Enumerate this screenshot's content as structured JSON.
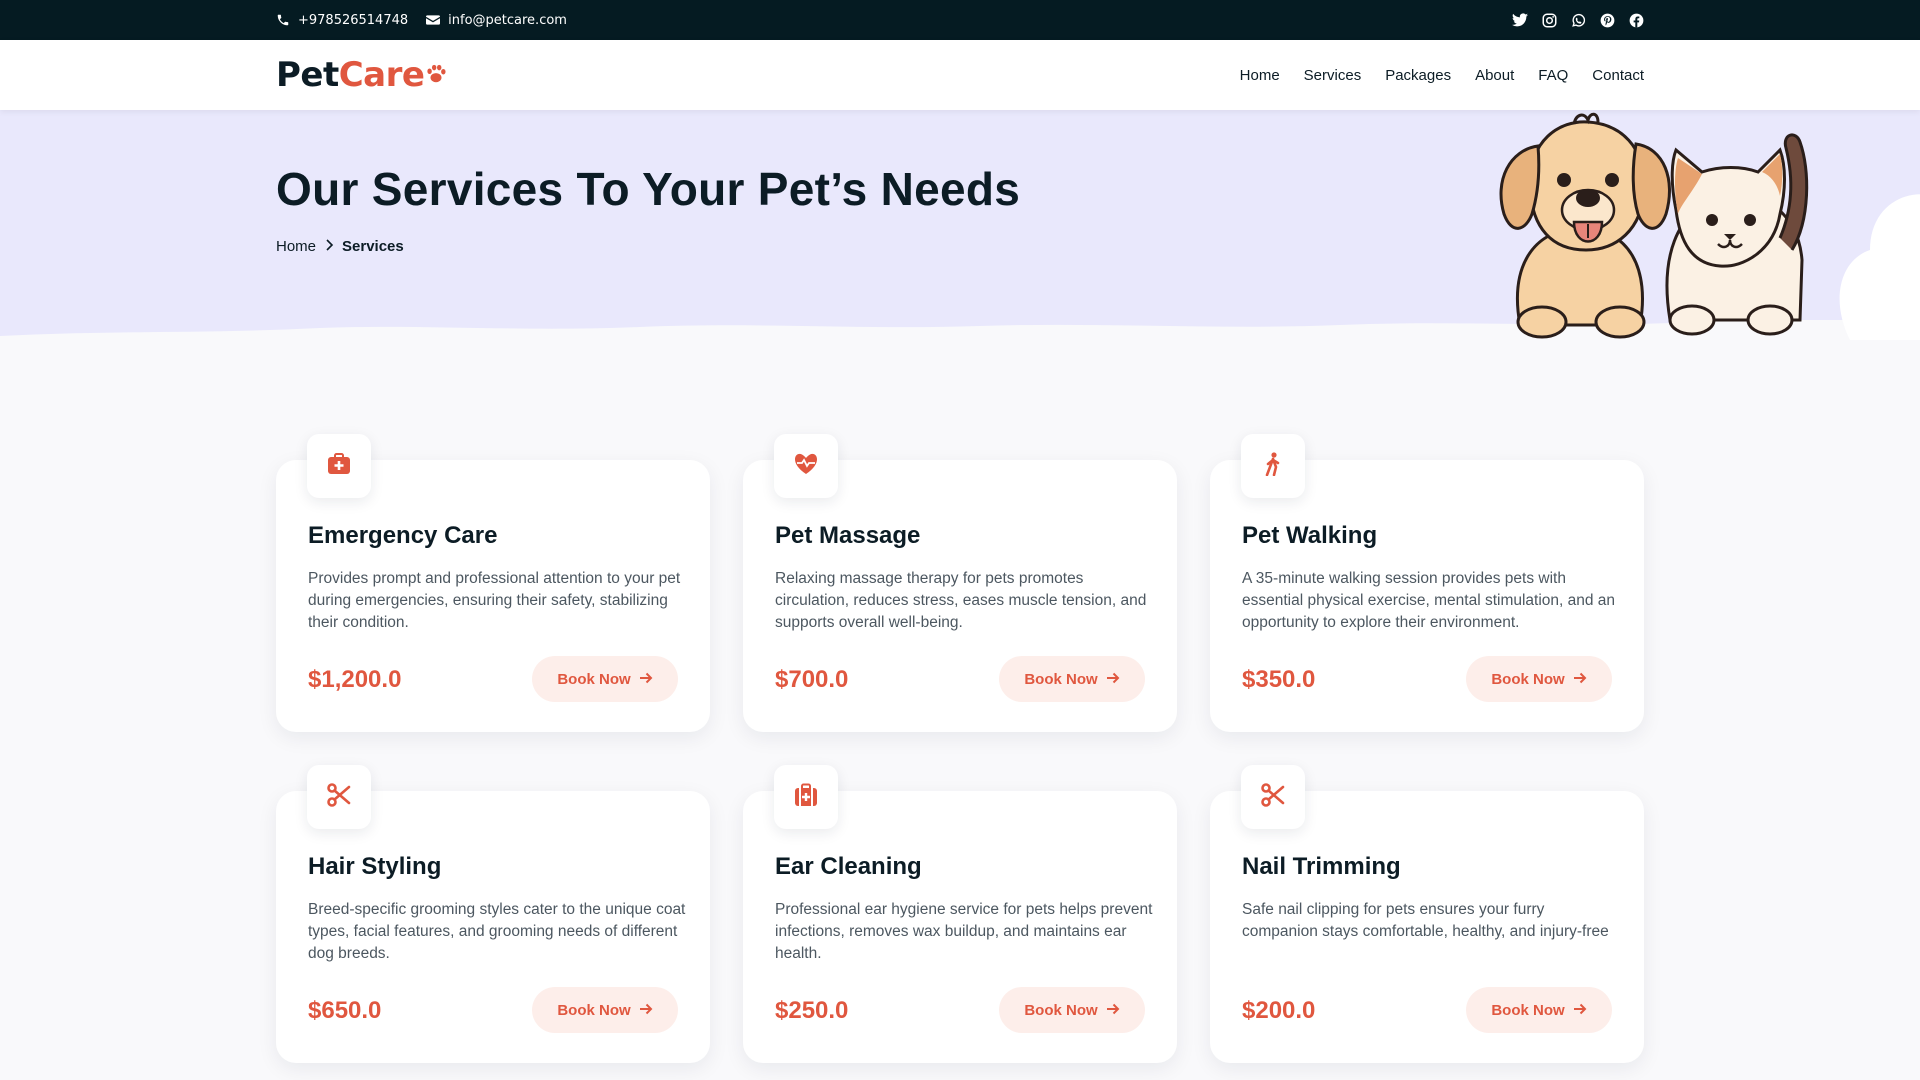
{
  "topbar": {
    "phone": "+978526514748",
    "email": "info@petcare.com",
    "social": [
      "twitter-icon",
      "instagram-icon",
      "whatsapp-icon",
      "pinterest-icon",
      "facebook-icon"
    ]
  },
  "brand": {
    "pet": "Pet",
    "care": "Care",
    "accent": "#e0573f",
    "dark": "#051b22"
  },
  "nav": {
    "items": [
      {
        "label": "Home"
      },
      {
        "label": "Services"
      },
      {
        "label": "Packages"
      },
      {
        "label": "About"
      },
      {
        "label": "FAQ"
      },
      {
        "label": "Contact"
      }
    ]
  },
  "hero": {
    "title": "Our Services To Your Pet’s Needs",
    "breadcrumb": {
      "home": "Home",
      "current": "Services"
    }
  },
  "services": [
    {
      "icon": "first-aid-kit-icon",
      "title": "Emergency Care",
      "desc": "Provides prompt and professional attention to your pet during emergencies, ensuring their safety, stabilizing their condition.",
      "price": "$1,200.0",
      "cta": "Book Now"
    },
    {
      "icon": "heart-pulse-icon",
      "title": "Pet Massage",
      "desc": "Relaxing massage therapy for pets promotes circulation, reduces stress, eases muscle tension, and supports overall well-being.",
      "price": "$700.0",
      "cta": "Book Now"
    },
    {
      "icon": "walking-person-icon",
      "title": "Pet Walking",
      "desc": "A 35-minute walking session provides pets with essential physical exercise, mental stimulation, and an opportunity to explore their environment.",
      "price": "$350.0",
      "cta": "Book Now"
    },
    {
      "icon": "scissors-icon",
      "title": "Hair Styling",
      "desc": "Breed-specific grooming styles cater to the unique coat types, facial features, and grooming needs of different dog breeds.",
      "price": "$650.0",
      "cta": "Book Now"
    },
    {
      "icon": "medical-bag-icon",
      "title": "Ear Cleaning",
      "desc": "Professional ear hygiene service for pets helps prevent infections, removes wax buildup, and maintains ear health.",
      "price": "$250.0",
      "cta": "Book Now"
    },
    {
      "icon": "scissors-icon",
      "title": "Nail Trimming",
      "desc": "Safe nail clipping for pets ensures your furry companion stays comfortable, healthy, and injury-free",
      "price": "$200.0",
      "cta": "Book Now"
    }
  ]
}
